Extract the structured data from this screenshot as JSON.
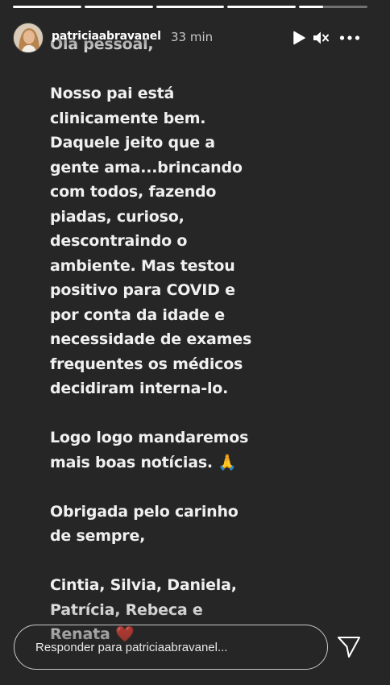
{
  "progress": {
    "segments": [
      1,
      1,
      1,
      1,
      0.35
    ]
  },
  "header": {
    "username": "patriciaabravanel",
    "time": "33 min",
    "icons": [
      "play-icon",
      "mute-icon",
      "more-icon"
    ]
  },
  "story": {
    "text": "Olá pessoal,\n\nNosso pai está\nclinicamente bem.\nDaquele jeito que a\ngente ama...brincando\ncom todos, fazendo\npiadas, curioso,\ndescontraindo o\nambiente.  Mas testou\npositivo para COVID e\npor conta da idade e\nnecessidade de exames\nfrequentes os médicos\ndecidiram interna-lo.\n\nLogo logo mandaremos\nmais boas notícias. 🙏\n\nObrigada pelo carinho\nde sempre,\n\nCintia, Silvia, Daniela,\nPatrícia, Rebeca e\nRenata ❤️"
  },
  "reply": {
    "placeholder": "Responder para patriciaabravanel..."
  },
  "colors": {
    "background": "#262626",
    "text": "#f0f0f0",
    "secondary_text": "#c7c7c7"
  }
}
